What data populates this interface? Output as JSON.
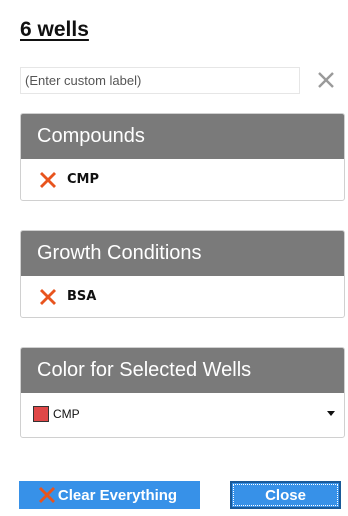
{
  "title": "6 wells",
  "custom_label": {
    "value": "",
    "placeholder": "(Enter custom label)",
    "clear_icon": "close-icon"
  },
  "compounds": {
    "header": "Compounds",
    "items": [
      {
        "label": "CMP",
        "icon": "remove-x-icon",
        "icon_color": "#e8541e"
      }
    ]
  },
  "growth_conditions": {
    "header": "Growth Conditions",
    "items": [
      {
        "label": "BSA",
        "icon": "remove-x-icon",
        "icon_color": "#e8541e"
      }
    ]
  },
  "color_panel": {
    "header": "Color for Selected Wells",
    "selected": "CMP",
    "swatch_color": "#e04848"
  },
  "buttons": {
    "clear_all": "Clear Everything",
    "close": "Close"
  },
  "colors": {
    "accent": "#3791e8",
    "panel_header": "#7a7a7a",
    "remove": "#e8541e"
  }
}
